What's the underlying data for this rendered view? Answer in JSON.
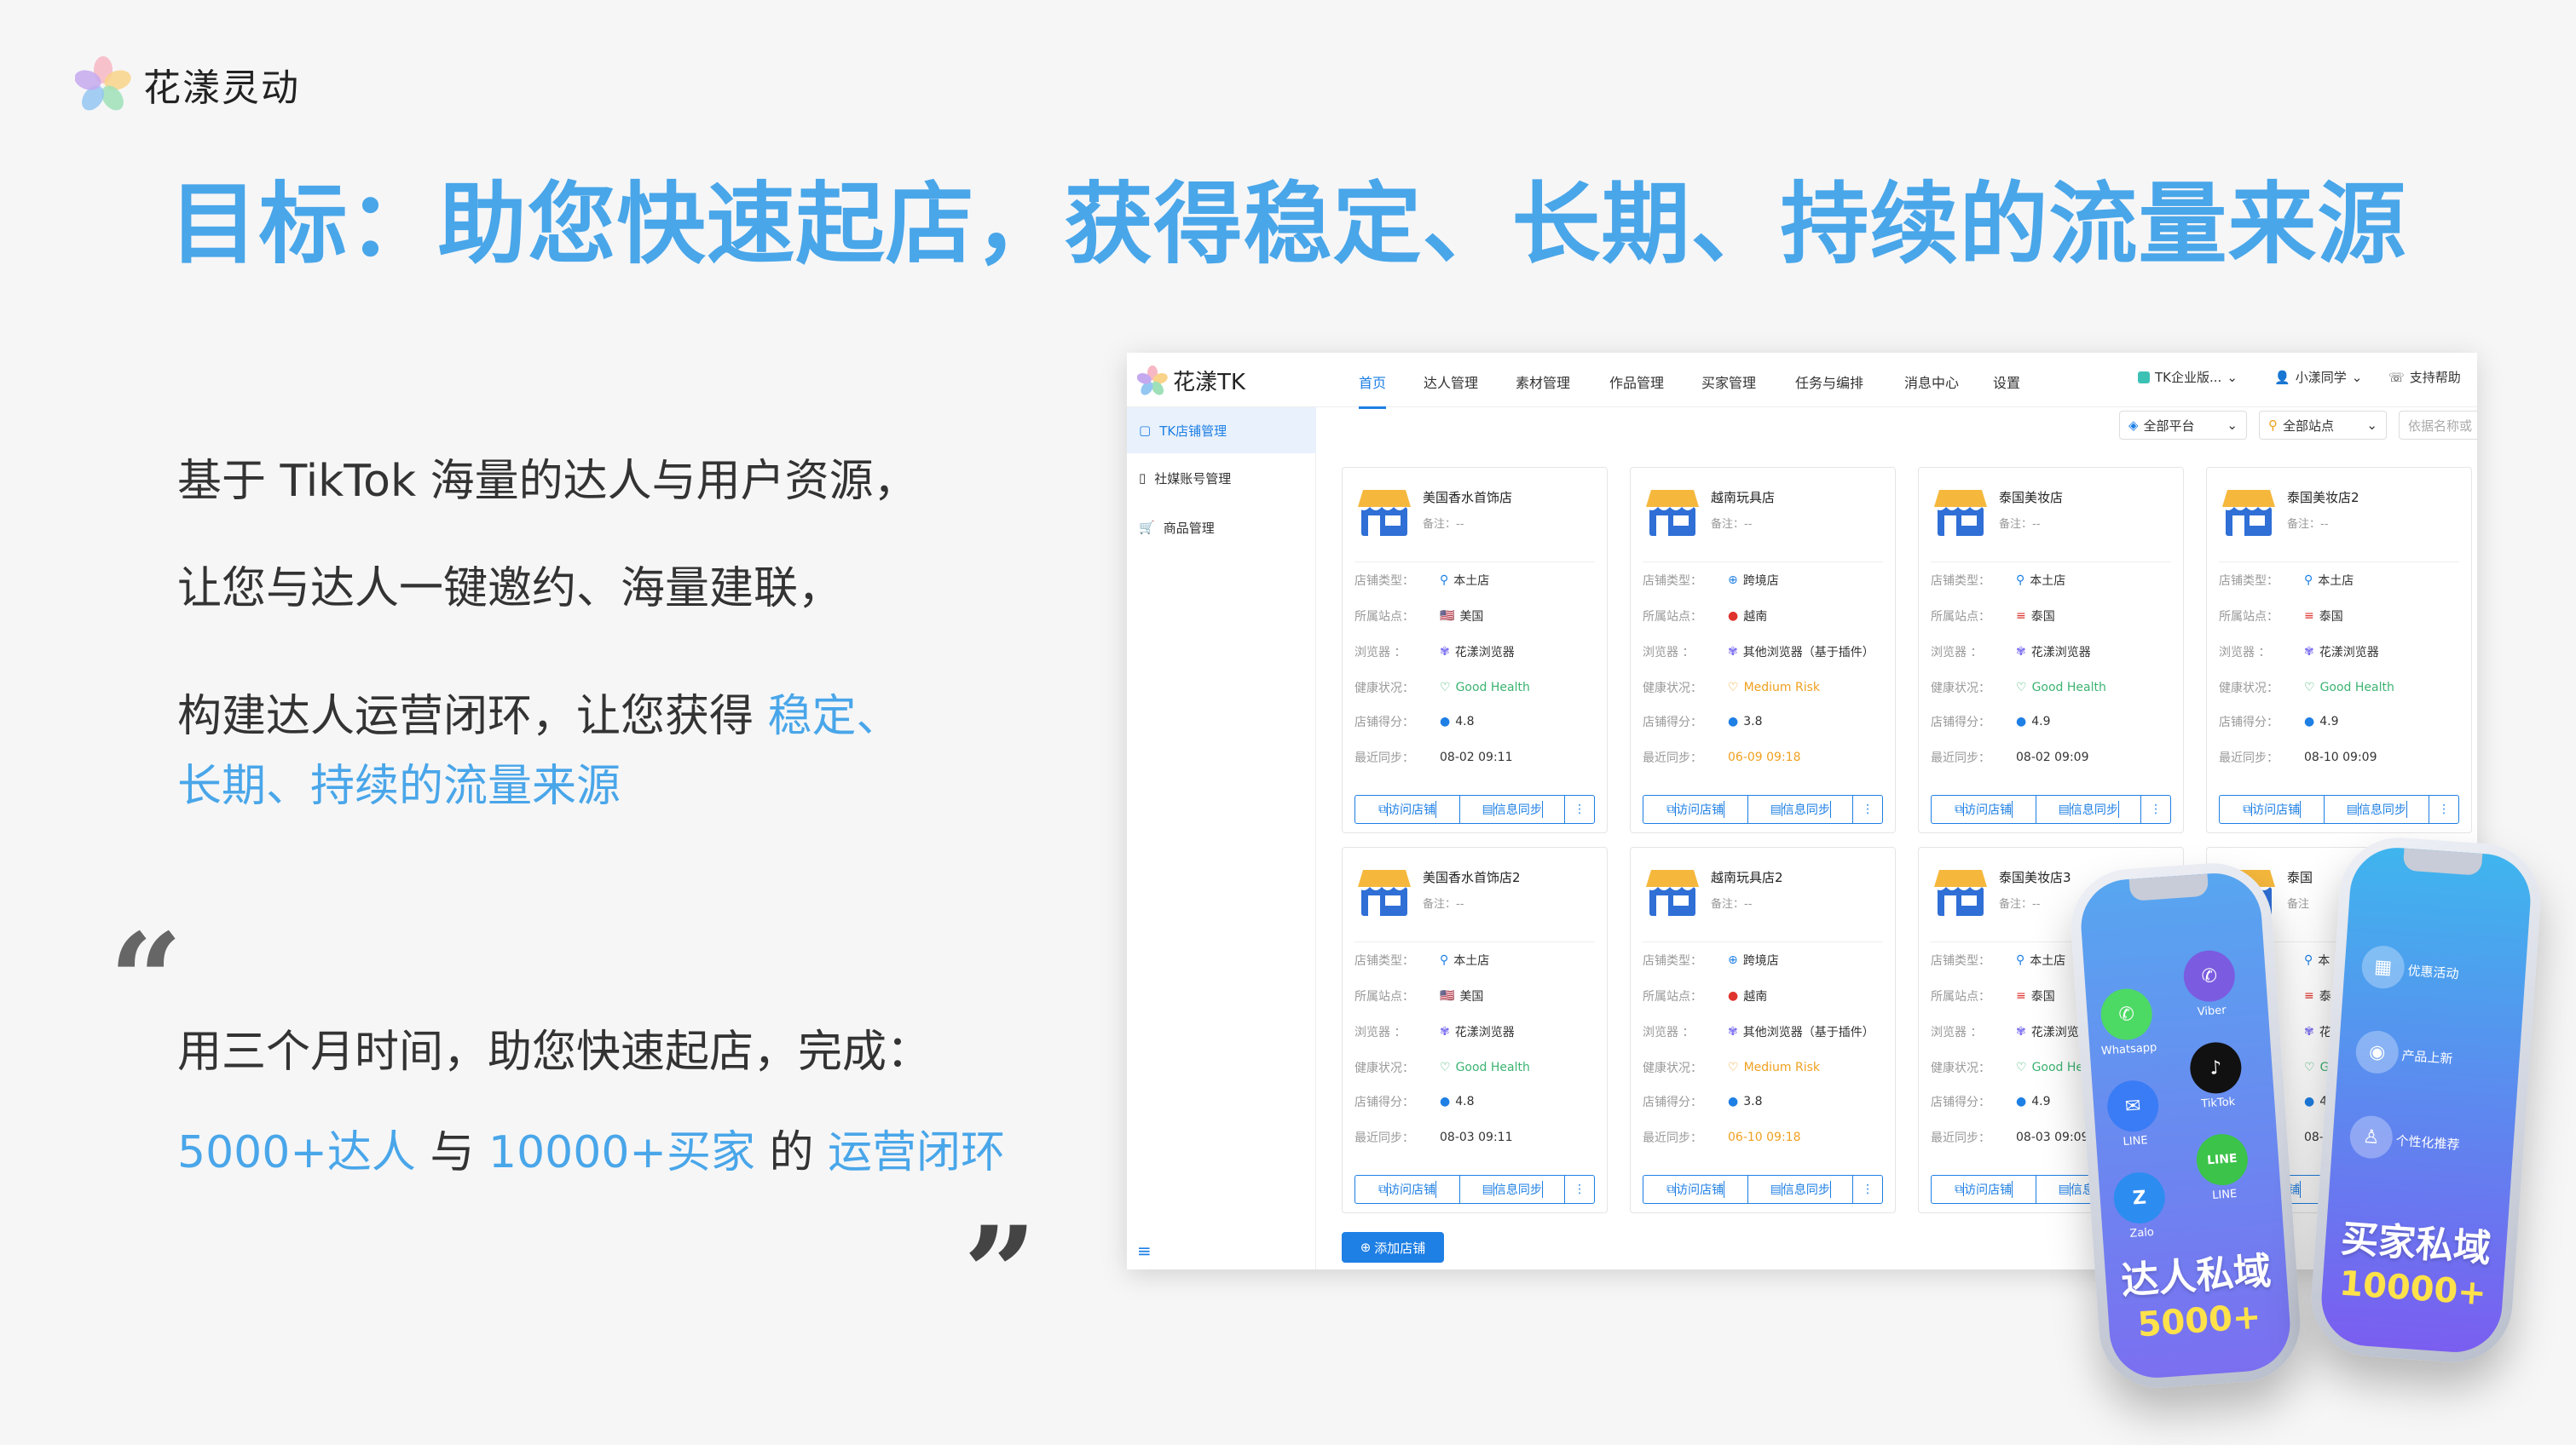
{
  "brand": {
    "name": "花漾灵动"
  },
  "headline": "目标：助您快速起店，获得稳定、长期、持续的流量来源",
  "intro": {
    "line1": "基于 TikTok 海量的达人与用户资源，",
    "line2": "让您与达人一键邀约、海量建联，",
    "line3_plain": "构建达人运营闭环，让您获得 ",
    "line3_hl": "稳定、",
    "line4_hl": "长期、持续的流量来源"
  },
  "quote": {
    "open": "“",
    "close": "”",
    "line1": "用三个月时间，助您快速起店，完成：",
    "part1": "5000+达人",
    "part2": " 与 ",
    "part3": "10000+买家",
    "part4": " 的 ",
    "part5": "运营闭环"
  },
  "app": {
    "brand": "花漾TK",
    "nav": [
      "首页",
      "达人管理",
      "素材管理",
      "作品管理",
      "买家管理",
      "任务与编排",
      "消息中心",
      "设置"
    ],
    "company": "TK企业版...",
    "user": "小漾同学",
    "help": "支持帮助",
    "sidebar": [
      "TK店铺管理",
      "社媒账号管理",
      "商品管理"
    ],
    "filters": {
      "platform": "全部平台",
      "site": "全部站点",
      "search_placeholder": "依据名称或"
    },
    "labels": {
      "type": "店铺类型：",
      "site": "所属站点：",
      "browser": "浏览器 ：",
      "health": "健康状况：",
      "score": "店铺得分：",
      "sync": "最近同步："
    },
    "buttons": {
      "visit": "访问店铺",
      "sync": "信息同步",
      "more": "⋮",
      "add": "添加店铺"
    },
    "stores": [
      {
        "name": "美国香水首饰店",
        "note": "备注：--",
        "type": "本土店",
        "site": "美国",
        "browser": "花漾浏览器",
        "health": "Good Health",
        "health_status": "good",
        "score": "4.8",
        "sync": "08-02 09:11",
        "sync_warn": false
      },
      {
        "name": "越南玩具店",
        "note": "备注：--",
        "type": "跨境店",
        "site": "越南",
        "browser": "其他浏览器（基于插件）",
        "health": "Medium Risk",
        "health_status": "risk",
        "score": "3.8",
        "sync": "06-09 09:18",
        "sync_warn": true
      },
      {
        "name": "泰国美妆店",
        "note": "备注：--",
        "type": "本土店",
        "site": "泰国",
        "browser": "花漾浏览器",
        "health": "Good Health",
        "health_status": "good",
        "score": "4.9",
        "sync": "08-02 09:09",
        "sync_warn": false
      },
      {
        "name": "泰国美妆店2",
        "note": "备注：--",
        "type": "本土店",
        "site": "泰国",
        "browser": "花漾浏览器",
        "health": "Good Health",
        "health_status": "good",
        "score": "4.9",
        "sync": "08-10 09:09",
        "sync_warn": false
      },
      {
        "name": "美国香水首饰店2",
        "note": "备注：--",
        "type": "本土店",
        "site": "美国",
        "browser": "花漾浏览器",
        "health": "Good Health",
        "health_status": "good",
        "score": "4.8",
        "sync": "08-03 09:11",
        "sync_warn": false
      },
      {
        "name": "越南玩具店2",
        "note": "备注：--",
        "type": "跨境店",
        "site": "越南",
        "browser": "其他浏览器（基于插件）",
        "health": "Medium Risk",
        "health_status": "risk",
        "score": "3.8",
        "sync": "06-10 09:18",
        "sync_warn": true
      },
      {
        "name": "泰国美妆店3",
        "note": "备注：--",
        "type": "本土店",
        "site": "泰国",
        "browser": "花漾浏览器",
        "health": "Good He",
        "health_status": "good",
        "score": "4.9",
        "sync": "08-03 09:09",
        "sync_warn": false
      },
      {
        "name": "泰国",
        "note": "备注",
        "type": "本",
        "site": "泰",
        "browser": "花",
        "health": "G",
        "health_status": "good",
        "score": "4.",
        "sync": "08-1",
        "sync_warn": false
      }
    ]
  },
  "phones": {
    "left": {
      "apps": [
        "Whatsapp",
        "Viber",
        "LINE",
        "TikTok",
        "Zalo",
        "LINE"
      ],
      "title": "达人私域",
      "count": "5000+"
    },
    "right": {
      "items": [
        "优惠活动",
        "产品上新",
        "个性化推荐"
      ],
      "title": "买家私域",
      "count": "10000+"
    }
  },
  "colors": {
    "accent": "#49a6e9",
    "primary": "#1e7fe4",
    "good": "#3cb371",
    "risk": "#f0a020"
  }
}
